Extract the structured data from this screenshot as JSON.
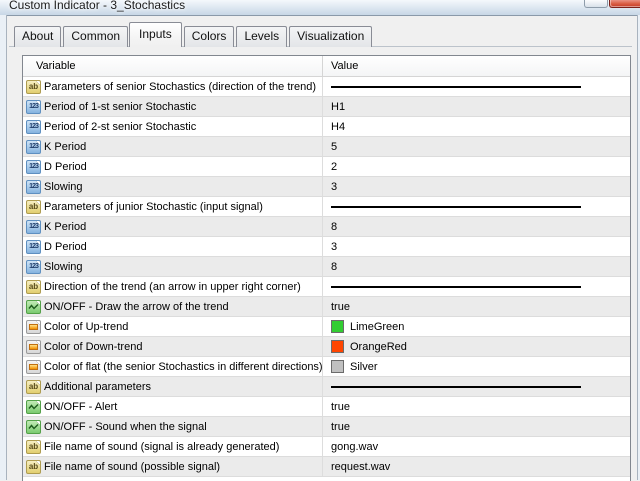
{
  "window": {
    "title": "Custom Indicator - 3_Stochastics"
  },
  "tabs": {
    "items": [
      "About",
      "Common",
      "Inputs",
      "Colors",
      "Levels",
      "Visualization"
    ],
    "active": "Inputs"
  },
  "icon_glyphs": {
    "string": "ab",
    "number": "123"
  },
  "table": {
    "columns": [
      "Variable",
      "Value"
    ],
    "rows": [
      {
        "type": "string",
        "label": "Parameters of senior Stochastics (direction of the trend)",
        "value": "",
        "separator": true
      },
      {
        "type": "number",
        "label": "Period of 1-st senior Stochastic",
        "value": "H1"
      },
      {
        "type": "number",
        "label": "Period of 2-st senior Stochastic",
        "value": "H4"
      },
      {
        "type": "number",
        "label": "K Period",
        "value": "5"
      },
      {
        "type": "number",
        "label": "D Period",
        "value": "2"
      },
      {
        "type": "number",
        "label": "Slowing",
        "value": "3"
      },
      {
        "type": "string",
        "label": "Parameters of junior Stochastic (input signal)",
        "value": "",
        "separator": true
      },
      {
        "type": "number",
        "label": "K Period",
        "value": "8"
      },
      {
        "type": "number",
        "label": "D Period",
        "value": "3"
      },
      {
        "type": "number",
        "label": "Slowing",
        "value": "8"
      },
      {
        "type": "string",
        "label": "Direction of the trend (an arrow in upper right corner)",
        "value": "",
        "separator": true
      },
      {
        "type": "bool",
        "label": "ON/OFF - Draw the arrow of the trend",
        "value": "true"
      },
      {
        "type": "color",
        "label": "Color of Up-trend",
        "value": "LimeGreen",
        "swatch": "#32CD32"
      },
      {
        "type": "color",
        "label": "Color of Down-trend",
        "value": "OrangeRed",
        "swatch": "#FF4500"
      },
      {
        "type": "color",
        "label": "Color of flat (the senior Stochastics in different directions)",
        "value": "Silver",
        "swatch": "#C0C0C0"
      },
      {
        "type": "string",
        "label": "Additional parameters",
        "value": "",
        "separator": true
      },
      {
        "type": "bool",
        "label": "ON/OFF - Alert",
        "value": "true"
      },
      {
        "type": "bool",
        "label": "ON/OFF - Sound when the signal",
        "value": "true"
      },
      {
        "type": "string",
        "label": "File name of sound (signal is already generated)",
        "value": "gong.wav"
      },
      {
        "type": "string",
        "label": "File name of sound (possible signal)",
        "value": "request.wav"
      }
    ]
  },
  "colors": {
    "row_alt": "#EBEBEB",
    "limegreen": "#32CD32",
    "orangered": "#FF4500",
    "silver": "#C0C0C0",
    "close_button_red": "#C23B28"
  }
}
